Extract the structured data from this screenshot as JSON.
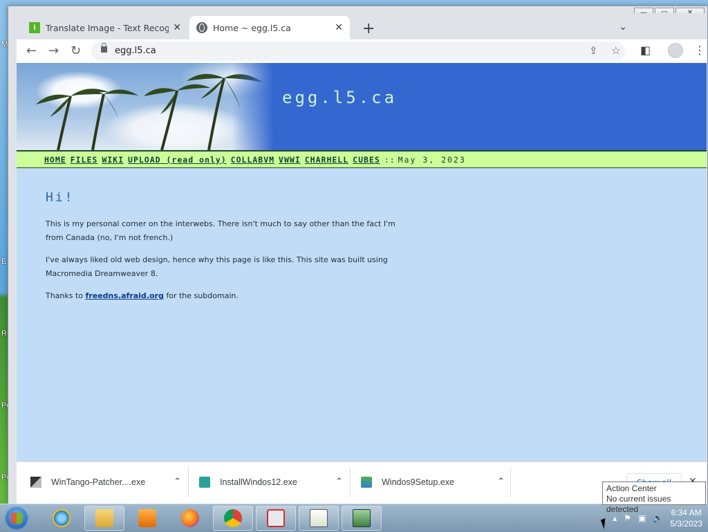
{
  "desktop": {
    "labels": [
      "M",
      "E",
      "Re",
      "Per",
      "Per"
    ]
  },
  "window": {
    "controls": {
      "minimize": "—",
      "maximize": "▭",
      "close": "✕"
    }
  },
  "tabs": [
    {
      "title": "Translate Image - Text Recognitic",
      "favicon": "green-i-icon",
      "active": false
    },
    {
      "title": "Home ~ egg.l5.ca",
      "favicon": "globe-icon",
      "active": true
    }
  ],
  "toolbar": {
    "url": "egg.l5.ca",
    "back": "←",
    "forward": "→",
    "reload": "↻",
    "share": "⇪",
    "star": "☆",
    "sidepanel": "◧",
    "menu": "⋮",
    "newtab": "+",
    "tab_dropdown": "⌄"
  },
  "page": {
    "site_title": "egg.l5.ca",
    "nav": [
      {
        "label": "HOME"
      },
      {
        "label": "FILES"
      },
      {
        "label": "WIKI"
      },
      {
        "label": "UPLOAD (read only)"
      },
      {
        "label": "COLLABVM"
      },
      {
        "label": "VWWI"
      },
      {
        "label": "CHARHELL"
      },
      {
        "label": "CUBES"
      }
    ],
    "nav_separator": "::",
    "date": "May 3, 2023",
    "heading": "Hi!",
    "p1": "This is my personal corner on the interwebs. There isn't much to say other than the fact I'm from Canada (no, I'm not french.)",
    "p2": "I've always liked old web design, hence why this page is like this. This site was built using Macromedia Dreamweaver 8.",
    "p3_before": "Thanks to ",
    "p3_link": "freedns.afraid.org",
    "p3_after": " for the subdomain."
  },
  "downloads": {
    "items": [
      {
        "name": "WinTango-Patcher....exe",
        "icon": "installer-icon"
      },
      {
        "name": "InstallWindos12.exe",
        "icon": "setup-icon"
      },
      {
        "name": "Windos9Setup.exe",
        "icon": "setup-icon"
      }
    ],
    "show_all": "Show all",
    "close": "✕",
    "chevron": "⌃"
  },
  "tooltip": {
    "title": "Action Center",
    "body": "No current issues detected"
  },
  "taskbar": {
    "apps": [
      "internet-explorer-icon",
      "file-explorer-icon",
      "media-player-icon",
      "firefox-icon",
      "chrome-icon",
      "snipping-tool-icon",
      "notepad-icon",
      "remote-desktop-icon"
    ],
    "tray_arrow": "▴",
    "time": "6:34 AM",
    "date": "5/3/2023"
  }
}
